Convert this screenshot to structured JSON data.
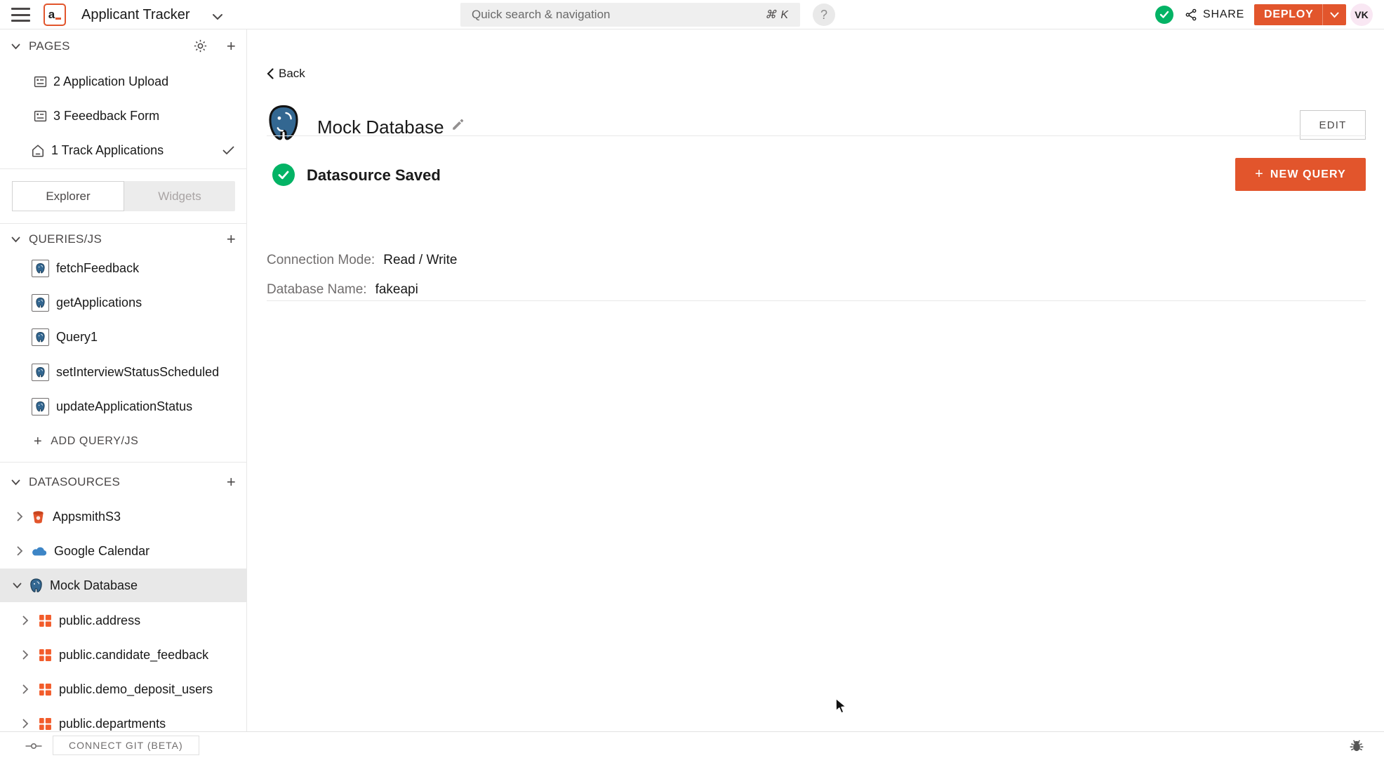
{
  "topbar": {
    "app_title": "Applicant Tracker",
    "search_placeholder": "Quick search & navigation",
    "search_shortcut": "⌘ K",
    "help_label": "?",
    "share_label": "SHARE",
    "deploy_label": "DEPLOY",
    "avatar_initials": "VK",
    "logo_letter": "a"
  },
  "glyphs": {
    "plus": "+"
  },
  "sidebar": {
    "pages": {
      "header": "PAGES",
      "items": [
        {
          "label": "2 Application Upload",
          "icon": "page-icon",
          "active": false
        },
        {
          "label": "3 Feeedback Form",
          "icon": "page-icon",
          "active": false
        },
        {
          "label": "1 Track Applications",
          "icon": "home-icon",
          "active": true
        }
      ]
    },
    "tabs": {
      "explorer": "Explorer",
      "widgets": "Widgets",
      "selected": "Explorer"
    },
    "queries": {
      "header": "QUERIES/JS",
      "items": [
        "fetchFeedback",
        "getApplications",
        "Query1",
        "setInterviewStatusScheduled",
        "updateApplicationStatus"
      ],
      "add_label": "ADD QUERY/JS"
    },
    "datasources": {
      "header": "DATASOURCES",
      "items": [
        {
          "label": "AppsmithS3",
          "icon": "s3-icon",
          "expanded": false
        },
        {
          "label": "Google Calendar",
          "icon": "cloud-icon",
          "expanded": false
        },
        {
          "label": "Mock Database",
          "icon": "postgres-icon",
          "expanded": true,
          "selected": true
        },
        {
          "label": "public.address",
          "icon": "table-icon"
        },
        {
          "label": "public.candidate_feedback",
          "icon": "table-icon"
        },
        {
          "label": "public.demo_deposit_users",
          "icon": "table-icon"
        },
        {
          "label": "public.departments",
          "icon": "table-icon"
        }
      ]
    }
  },
  "main": {
    "back_label": "Back",
    "title": "Mock Database",
    "edit_button": "EDIT",
    "status": "Datasource Saved",
    "new_query_label": "NEW QUERY",
    "fields": [
      {
        "label": "Connection Mode:",
        "value": "Read / Write"
      },
      {
        "label": "Database Name:",
        "value": "fakeapi"
      }
    ]
  },
  "bottombar": {
    "connect_git": "CONNECT GIT (BETA)"
  },
  "colors": {
    "accent_orange": "#E2552C",
    "success_green": "#03B365",
    "postgres_blue": "#336791",
    "gcal_blue": "#3D85C6",
    "table_orange": "#F25C2B",
    "avatar_pink": "#F9E7F3"
  }
}
